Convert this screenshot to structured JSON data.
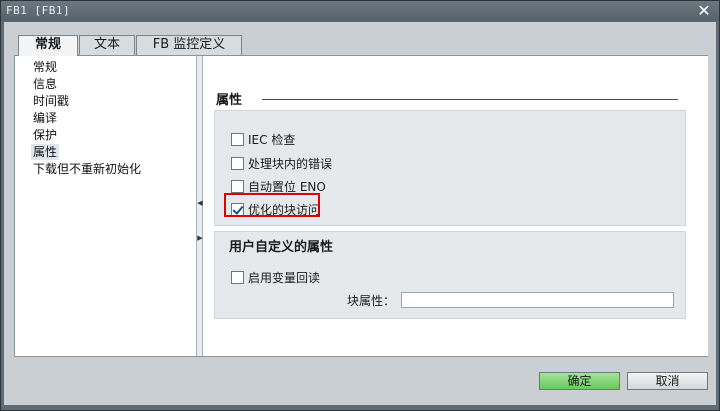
{
  "window": {
    "title": "FB1 [FB1]",
    "close_glyph": "✕"
  },
  "tabs": [
    {
      "label": "常规",
      "active": true
    },
    {
      "label": "文本",
      "active": false
    },
    {
      "label": "FB 监控定义",
      "active": false
    }
  ],
  "nav": {
    "items": [
      {
        "label": "常规",
        "selected": false
      },
      {
        "label": "信息",
        "selected": false
      },
      {
        "label": "时间戳",
        "selected": false
      },
      {
        "label": "编译",
        "selected": false
      },
      {
        "label": "保护",
        "selected": false
      },
      {
        "label": "属性",
        "selected": true
      },
      {
        "label": "下载但不重新初始化",
        "selected": false
      }
    ]
  },
  "attributes": {
    "title": "属性",
    "options": [
      {
        "label": "IEC 检查",
        "checked": false
      },
      {
        "label": "处理块内的错误",
        "checked": false
      },
      {
        "label": "自动置位 ENO",
        "checked": false
      },
      {
        "label": "优化的块访问",
        "checked": true
      }
    ]
  },
  "user_attributes": {
    "title": "用户自定义的属性",
    "enable_readback": {
      "label": "启用变量回读",
      "checked": false
    },
    "block_attribute": {
      "label": "块属性：",
      "value": ""
    }
  },
  "footer": {
    "ok_label": "确定",
    "cancel_label": "取消"
  },
  "colors": {
    "ok_button": "#7fd16f",
    "highlight": "#e00000",
    "selected_nav": "#dfe7ee"
  }
}
